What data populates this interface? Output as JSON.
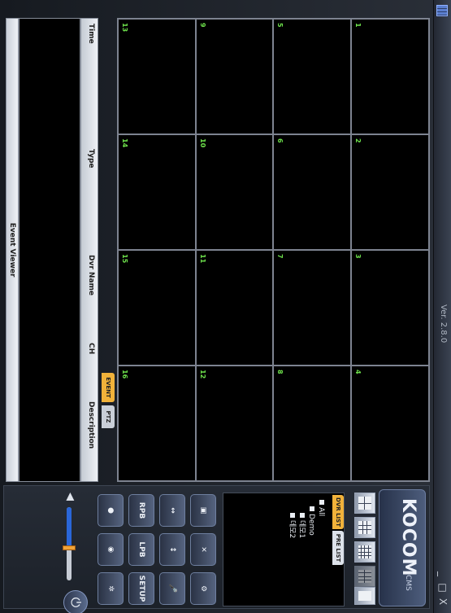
{
  "window": {
    "version": "Ver. 2.8.0",
    "minimize": "_",
    "maximize": "□",
    "close": "X"
  },
  "brand": {
    "logo": "KOCOM",
    "sub": "CMS"
  },
  "camera_grid": {
    "cells": [
      "1",
      "2",
      "3",
      "4",
      "5",
      "6",
      "7",
      "8",
      "9",
      "10",
      "11",
      "12",
      "13",
      "14",
      "15",
      "16"
    ]
  },
  "dvr_panel": {
    "tabs": [
      "DVR LIST",
      "PRE LIST"
    ],
    "tree": [
      "All",
      "Demo",
      "데모1",
      "데모2"
    ]
  },
  "functions": {
    "buttons": [
      "",
      "",
      "",
      "",
      "",
      "",
      "",
      "",
      "RPB",
      "LPB",
      "SETUP",
      "",
      "",
      ""
    ]
  },
  "event_viewer": {
    "tabs": [
      "EVENT",
      "PTZ"
    ],
    "columns": [
      "Time",
      "Type",
      "Dvr Name",
      "CH",
      "Description"
    ],
    "footer": "Event Viewer"
  },
  "colors": {
    "accent": "#f1b23a",
    "volume": "#2a66d8",
    "cam_number": "#6ee24c"
  },
  "volume_level": 0.55
}
